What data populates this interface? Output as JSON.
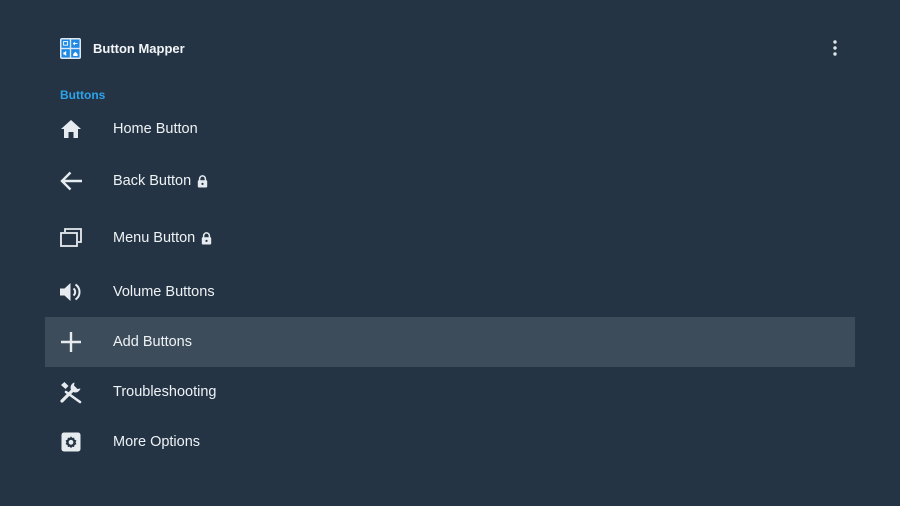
{
  "app": {
    "title": "Button Mapper",
    "icon": "button-mapper-logo",
    "menu_icon": "more-vert-icon"
  },
  "section": {
    "title": "Buttons"
  },
  "colors": {
    "background": "#243444",
    "selected_row": "#3d4c5a",
    "accent": "#2ea3ea",
    "text": "#eef2f5"
  },
  "items": [
    {
      "label": "Home Button",
      "icon": "home-icon",
      "locked": false,
      "selected": false
    },
    {
      "label": "Back Button",
      "icon": "back-arrow-icon",
      "locked": true,
      "selected": false
    },
    {
      "label": "Menu Button",
      "icon": "recent-apps-icon",
      "locked": true,
      "selected": false
    },
    {
      "label": "Volume Buttons",
      "icon": "volume-icon",
      "locked": false,
      "selected": false
    },
    {
      "label": "Add Buttons",
      "icon": "plus-icon",
      "locked": false,
      "selected": true
    },
    {
      "label": "Troubleshooting",
      "icon": "tools-icon",
      "locked": false,
      "selected": false
    },
    {
      "label": "More Options",
      "icon": "settings-icon",
      "locked": false,
      "selected": false
    }
  ]
}
